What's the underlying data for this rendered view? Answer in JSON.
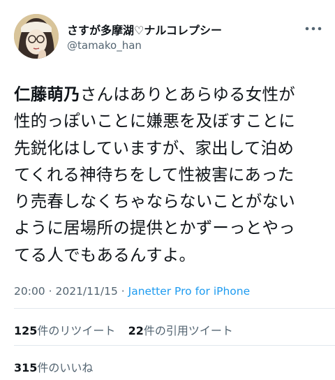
{
  "author": {
    "display_name": "さすが多摩湖♡ナルコレプシー",
    "handle": "@tamako_han",
    "avatar_icon": "avatar-illustration"
  },
  "more_icon": "more-options-icon",
  "tweet": {
    "lines": [
      {
        "mention": "仁藤萌乃",
        "text": "さんはありとあらゆる女性が"
      },
      {
        "text": "性的っぽいことに嫌悪を及ぼすことに"
      },
      {
        "text": "先鋭化はしていますが、家出して泊め"
      },
      {
        "text": "てくれる神待ちをして性被害にあった"
      },
      {
        "text": "り売春しなくちゃならないことがない"
      },
      {
        "text": "ように居場所の提供とかずーっとやっ"
      },
      {
        "text": "てる人でもあるんすよ。"
      }
    ]
  },
  "meta": {
    "time": "20:00",
    "date": "2021/11/15",
    "separator": "·",
    "client": "Janetter Pro for iPhone"
  },
  "stats": {
    "retweets_count": "125",
    "retweets_label": "件のリツイート",
    "quotes_count": "22",
    "quotes_label": "件の引用ツイート",
    "likes_count": "315",
    "likes_label": "件のいいね"
  },
  "colors": {
    "text": "#0f1419",
    "secondary": "#536471",
    "link": "#1d9bf0",
    "divider": "#e1e8ed"
  }
}
